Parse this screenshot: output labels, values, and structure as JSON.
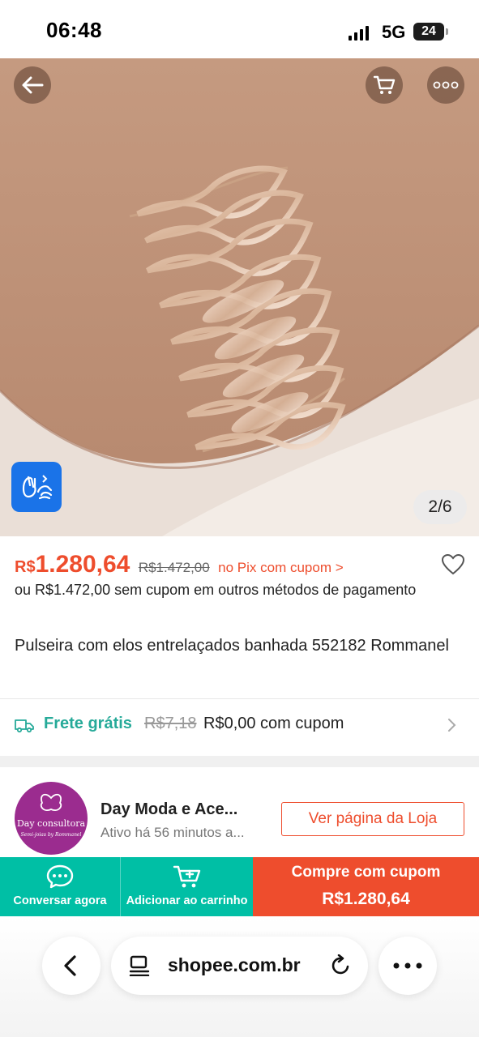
{
  "status_bar": {
    "time": "06:48",
    "network": "5G",
    "battery": "24"
  },
  "gallery": {
    "counter": "2/6"
  },
  "price": {
    "currency": "R$",
    "value": "1.280,64",
    "old": "R$1.472,00",
    "pix_note": "no Pix com cupom >",
    "alternative": "ou R$1.472,00 sem cupom em outros métodos de pagamento"
  },
  "product": {
    "title": "Pulseira com elos entrelaçados banhada 552182 Rommanel"
  },
  "shipping": {
    "free_label": "Frete grátis",
    "old_price": "R$7,18",
    "new_price": "R$0,00 com cupom"
  },
  "shop": {
    "logo_text": "Day consultora",
    "logo_tagline": "Semi-joias by Rommanel",
    "name": "Day Moda e Ace...",
    "active": "Ativo há 56 minutos a...",
    "view_button": "Ver página da Loja"
  },
  "actions": {
    "chat_label": "Conversar agora",
    "cart_label": "Adicionar ao carrinho",
    "buy_line1": "Compre com cupom",
    "buy_line2": "R$1.280,64"
  },
  "browser": {
    "url": "shopee.com.br"
  },
  "colors": {
    "brand": "#ee4d2d",
    "teal": "#00bfa5",
    "free_shipping": "#26aa99",
    "shop_logo_bg": "#9b2c8f"
  },
  "icons": [
    "back-arrow-icon",
    "cart-icon",
    "more-dots-icon",
    "libras-hands-icon",
    "heart-icon",
    "truck-icon",
    "chevron-right-icon",
    "chat-icon",
    "cart-plus-icon",
    "chevron-left-icon",
    "reader-icon",
    "reload-icon"
  ]
}
